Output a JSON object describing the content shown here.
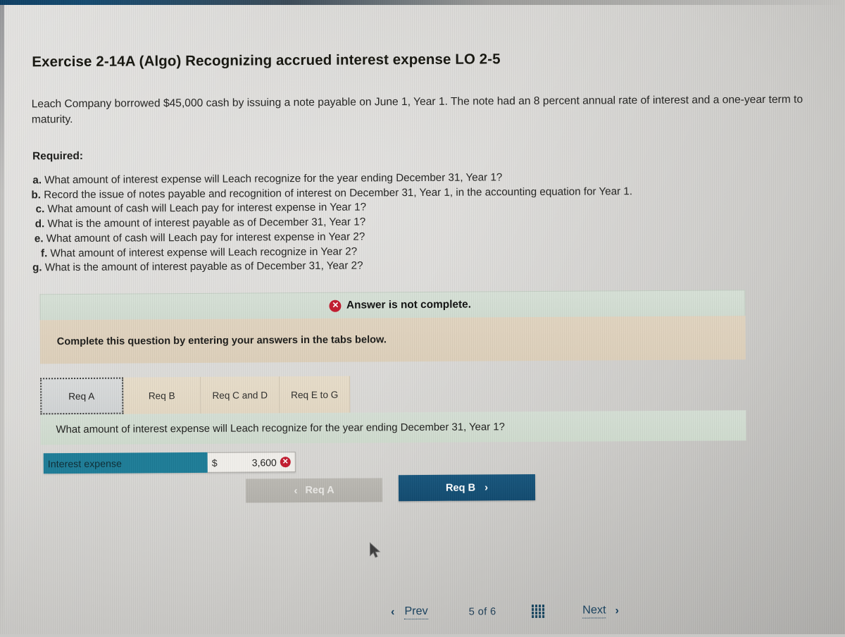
{
  "header": {
    "title": "Exercise 2-14A (Algo) Recognizing accrued interest expense LO 2-5",
    "intro": "Leach Company borrowed $45,000 cash by issuing a note payable on June 1, Year 1. The note had an 8 percent annual rate of interest and a one-year term to maturity.",
    "required_label": "Required:"
  },
  "requirements": [
    {
      "letter": "a.",
      "text": "What amount of interest expense will Leach recognize for the year ending December 31, Year 1?"
    },
    {
      "letter": "b.",
      "text": "Record the issue of notes payable and recognition of interest on December 31, Year 1, in the accounting equation for Year 1."
    },
    {
      "letter": "c.",
      "text": "What amount of cash will Leach pay for interest expense in Year 1?"
    },
    {
      "letter": "d.",
      "text": "What is the amount of interest payable as of December 31, Year 1?"
    },
    {
      "letter": "e.",
      "text": "What amount of cash will Leach pay for interest expense in Year 2?"
    },
    {
      "letter": "f.",
      "text": "What amount of interest expense will Leach recognize in Year 2?"
    },
    {
      "letter": "g.",
      "text": "What is the amount of interest payable as of December 31, Year 2?"
    }
  ],
  "panel": {
    "status_text": "Answer is not complete.",
    "status_icon": "x-circle-icon",
    "instruction": "Complete this question by entering your answers in the tabs below."
  },
  "tabs": [
    {
      "label": "Req A",
      "active": true
    },
    {
      "label": "Req B",
      "active": false
    },
    {
      "label": "Req C and D",
      "active": false
    },
    {
      "label": "Req E to G",
      "active": false
    }
  ],
  "question": {
    "prompt": "What amount of interest expense will Leach recognize for the year ending December 31, Year 1?"
  },
  "answer_row": {
    "label": "Interest expense",
    "currency_symbol": "$",
    "value": "3,600",
    "status_icon": "x-circle-icon"
  },
  "nav": {
    "prev_label": "Req A",
    "prev_chevron": "‹",
    "next_label": "Req B",
    "next_chevron": "›"
  },
  "pager": {
    "prev_chevron": "‹",
    "prev_label": "Prev",
    "count_label": "5 of 6",
    "grid_icon": "grid-icon",
    "next_label": "Next",
    "next_chevron": "›"
  },
  "colors": {
    "status_banner": "#d3ddd3",
    "instruction_banner": "#ded0bc",
    "tab_active": "#d4d7d8",
    "tab_inactive": "#e3d8c5",
    "answer_label_highlight": "#1d7c97",
    "primary_button": "#15527a",
    "disabled_button": "#b6b4ae",
    "error_red": "#c21b2e",
    "pager_link": "#17405d"
  },
  "x_glyph": "✕"
}
